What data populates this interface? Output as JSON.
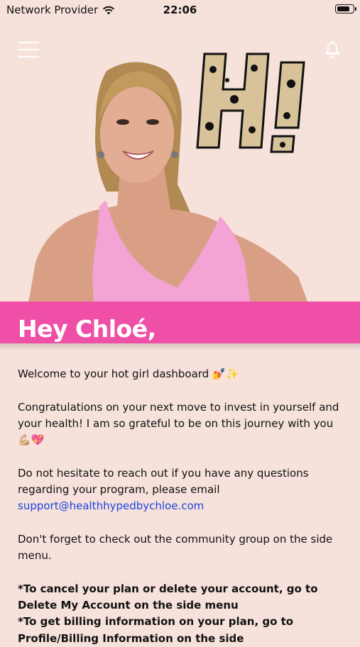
{
  "status_bar": {
    "carrier": "Network Provider",
    "time": "22:06",
    "battery_level": 0.85
  },
  "header": {
    "menu_icon": "hamburger-menu-icon",
    "notification_icon": "bell-icon",
    "logo_text": "Hi"
  },
  "hero": {
    "greeting": "Hey Chloé,",
    "band_color": "#ef4fa6"
  },
  "content": {
    "welcome": "Welcome to your hot girl dashboard 💅✨",
    "congrats": "Congratulations on your next move to invest in yourself and your health! I am so grateful to be on this journey with you 💪🏼💖",
    "contact_text": "Do not hesitate to reach out if you have any questions regarding your program, please email",
    "support_email": "support@healthhypedbychloe.com",
    "community": "Don't forget to check out the community group on the side menu.",
    "cancel_note": "*To cancel your plan or delete your account, go to Delete My Account on the side menu",
    "billing_note": "*To get billing information on your plan, go to Profile/Billing Information on the side"
  }
}
